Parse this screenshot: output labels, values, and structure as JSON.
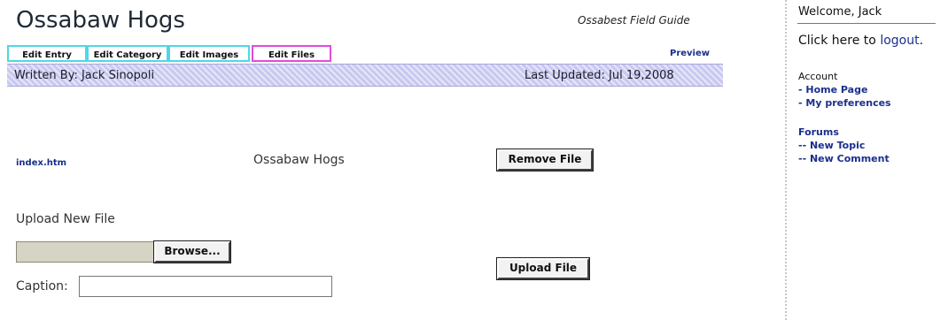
{
  "header": {
    "title": "Ossabaw Hogs",
    "guide": "Ossabest Field Guide",
    "preview_label": "Preview"
  },
  "tabs": [
    {
      "label": "Edit Entry"
    },
    {
      "label": "Edit Category"
    },
    {
      "label": "Edit Images"
    },
    {
      "label": "Edit Files"
    }
  ],
  "byline": {
    "written_by": "Written By: Jack Sinopoli",
    "last_updated": "Last Updated: Jul 19,2008"
  },
  "file": {
    "link": "index.htm",
    "name": "Ossabaw Hogs",
    "remove_label": "Remove File"
  },
  "upload": {
    "label": "Upload New File",
    "browse_label": "Browse...",
    "caption_label": "Caption:",
    "caption_value": "",
    "upload_label": "Upload File"
  },
  "sidebar": {
    "welcome": "Welcome, Jack",
    "logout_prefix": "Click here to ",
    "logout_link": "logout",
    "logout_suffix": ".",
    "account_heading": "Account",
    "account_links": [
      "- Home Page",
      "- My preferences"
    ],
    "forums_heading": "Forums",
    "forums_links": [
      "-- New Topic",
      "-- New Comment"
    ]
  },
  "colors": {
    "link": "#1a2f8c",
    "tab_cyan": "#4dd8e6",
    "tab_magenta": "#e04bdc",
    "byline_bar": "#c8c8f0"
  }
}
